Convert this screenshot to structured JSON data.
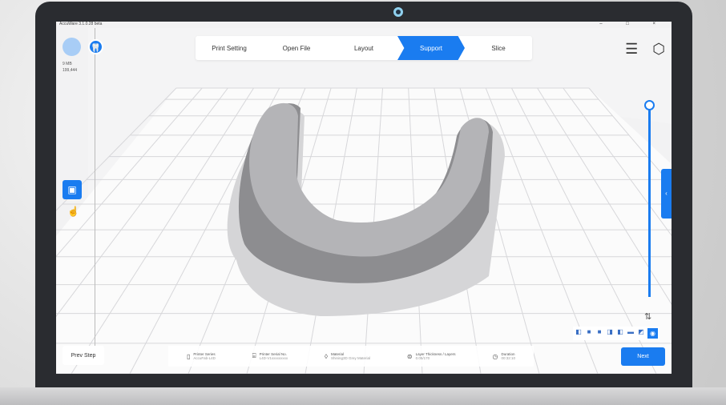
{
  "window": {
    "title": "AccuWare 3.1.0.28 beta",
    "controls": "– □ ×"
  },
  "steps": [
    {
      "label": "Print Setting"
    },
    {
      "label": "Open File"
    },
    {
      "label": "Layout"
    },
    {
      "label": "Support",
      "active": true
    },
    {
      "label": "Slice"
    }
  ],
  "left": {
    "size": "9 MB",
    "triangles": "199,444"
  },
  "footer": [
    {
      "icon": "printer-icon",
      "label": "Printer Series",
      "value": "AccuFab-L4D"
    },
    {
      "icon": "serial-icon",
      "label": "Printer Serial No.",
      "value": "L4D-V1xxxxxxxxx"
    },
    {
      "icon": "material-icon",
      "label": "Material",
      "value": "Shining3D Grey Material"
    },
    {
      "icon": "layers-icon",
      "label": "Layer Thickness / Layers",
      "value": "0.05/170"
    },
    {
      "icon": "clock-icon",
      "label": "Duration",
      "value": "00:32:10"
    }
  ],
  "buttons": {
    "prev": "Prev Step",
    "next": "Next"
  },
  "accent": "#1a7cf0"
}
